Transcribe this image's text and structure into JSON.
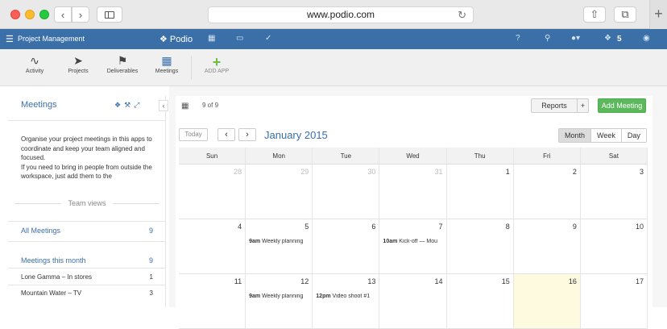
{
  "browser": {
    "url": "www.podio.com"
  },
  "header": {
    "workspace": "Project Management",
    "logo": "Podio",
    "notifications": "5"
  },
  "apps": [
    {
      "label": "Activity",
      "icon": "activity-icon"
    },
    {
      "label": "Projects",
      "icon": "rocket-icon"
    },
    {
      "label": "Deliverables",
      "icon": "flags-icon"
    },
    {
      "label": "Meetings",
      "icon": "calendar-icon"
    },
    {
      "label": "ADD APP",
      "icon": "plus-icon"
    }
  ],
  "sidebar": {
    "title": "Meetings",
    "description": "Organise your project meetings in this apps to coordinate and keep your team aligned and focused.\nIf you need to bring in people from outside the workspace, just add them to the",
    "team_views": "Team views",
    "all_meetings": {
      "label": "All Meetings",
      "count": "9"
    },
    "this_month": {
      "label": "Meetings this month",
      "count": "9"
    },
    "items": [
      {
        "label": "Lone Gamma – In stores",
        "count": "1"
      },
      {
        "label": "Mountain Water – TV",
        "count": "3"
      }
    ]
  },
  "toolbar": {
    "count": "9 of 9",
    "reports": "Reports",
    "reports_add": "+",
    "add_meeting": "Add Meeting"
  },
  "calendar": {
    "today": "Today",
    "month": "January 2015",
    "views": [
      "Month",
      "Week",
      "Day"
    ],
    "days_of_week": [
      "Sun",
      "Mon",
      "Tue",
      "Wed",
      "Thu",
      "Fri",
      "Sat"
    ],
    "weeks": [
      [
        {
          "n": "28",
          "other": true
        },
        {
          "n": "29",
          "other": true
        },
        {
          "n": "30",
          "other": true
        },
        {
          "n": "31",
          "other": true
        },
        {
          "n": "1"
        },
        {
          "n": "2"
        },
        {
          "n": "3"
        }
      ],
      [
        {
          "n": "4"
        },
        {
          "n": "5",
          "time": "9am",
          "title": "Weekly planning"
        },
        {
          "n": "6"
        },
        {
          "n": "7",
          "time": "10am",
          "title": "Kick-off — Mou"
        },
        {
          "n": "8"
        },
        {
          "n": "9"
        },
        {
          "n": "10"
        }
      ],
      [
        {
          "n": "11"
        },
        {
          "n": "12",
          "time": "9am",
          "title": "Weekly planning"
        },
        {
          "n": "13",
          "time": "12pm",
          "title": "Video shoot #1"
        },
        {
          "n": "14"
        },
        {
          "n": "15"
        },
        {
          "n": "16",
          "today": true
        },
        {
          "n": "17"
        }
      ]
    ]
  }
}
